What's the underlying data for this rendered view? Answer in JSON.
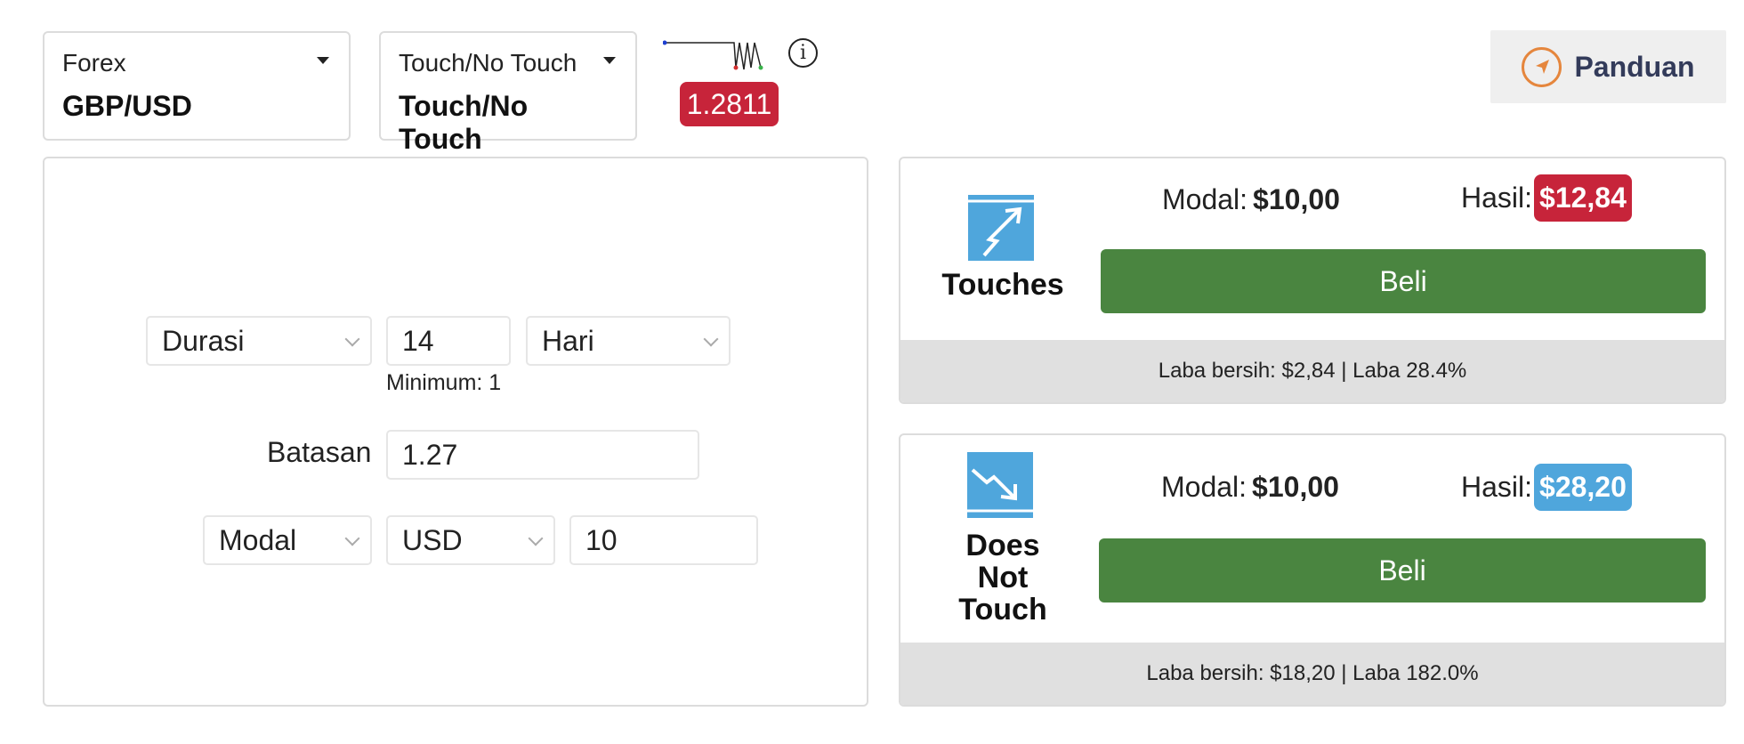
{
  "header": {
    "underlying": {
      "category": "Forex",
      "symbol": "GBP/USD"
    },
    "contract": {
      "category": "Touch/No Touch",
      "type": "Touch/No Touch"
    },
    "spot_price": "1.2811",
    "guide_label": "Panduan"
  },
  "form": {
    "duration_type": "Durasi",
    "duration_value": "14",
    "duration_unit": "Hari",
    "duration_min_hint": "Minimum: 1",
    "barrier_label": "Batasan",
    "barrier_value": "1.27",
    "amount_type": "Modal",
    "currency": "USD",
    "amount_value": "10"
  },
  "cards": [
    {
      "name": "Touches",
      "stake_label": "Modal:",
      "stake_value": "$10,00",
      "payout_label": "Hasil:",
      "payout_value": "$12,84",
      "payout_color": "#c7243a",
      "buy_label": "Beli",
      "profit_text": "Laba bersih: $2,84 | Laba 28.4%"
    },
    {
      "name_lines": [
        "Does",
        "Not",
        "Touch"
      ],
      "stake_label": "Modal:",
      "stake_value": "$10,00",
      "payout_label": "Hasil:",
      "payout_value": "$28,20",
      "payout_color": "#4fa6dc",
      "buy_label": "Beli",
      "profit_text": "Laba bersih: $18,20 | Laba 182.0%"
    }
  ],
  "colors": {
    "buy_button": "#4a8540",
    "spot_badge": "#c7243a",
    "contract_icon": "#4fa6dc",
    "guide_icon": "#e5863d"
  }
}
